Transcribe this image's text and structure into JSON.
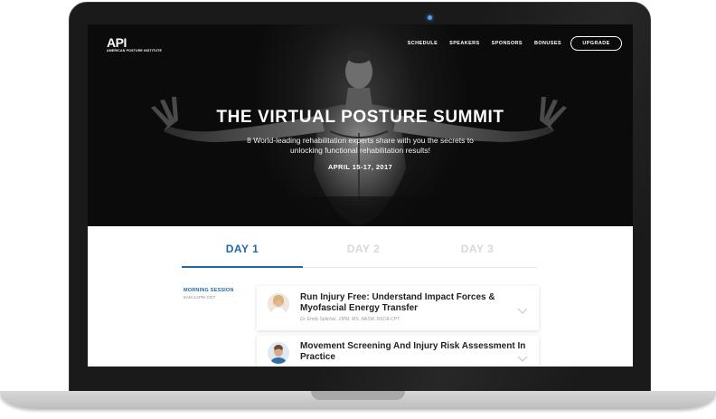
{
  "site": {
    "logo_text": "API",
    "logo_subtext": "AMERICAN POSTURE INSTITUTE"
  },
  "nav": {
    "items": [
      "SCHEDULE",
      "SPEAKERS",
      "SPONSORS",
      "BONUSES"
    ],
    "upgrade_label": "UPGRADE"
  },
  "hero": {
    "title": "THE VIRTUAL POSTURE SUMMIT",
    "subtitle": "8 World-leading rehabilitation experts share with you the secrets to unlocking functional rehabilitation results!",
    "date": "APRIL 15-17, 2017"
  },
  "tabs": [
    {
      "label": "DAY 1",
      "active": true
    },
    {
      "label": "DAY 2",
      "active": false
    },
    {
      "label": "DAY 3",
      "active": false
    }
  ],
  "session": {
    "label": "MORNING SESSION",
    "time": "9AM-12PM CDT"
  },
  "talks": [
    {
      "title": "Run Injury Free:  Understand Impact Forces & Myofascial Energy Transfer",
      "speaker": "Dr. Emily Splichal , DPM, MS, NASM, NSCA-CPT"
    },
    {
      "title": "Movement Screening And Injury Risk Assessment In Practice",
      "speaker": ""
    }
  ],
  "colors": {
    "accent": "#1e6aa8",
    "hero_bg": "#111111",
    "tab_inactive": "#d8d8d8"
  }
}
